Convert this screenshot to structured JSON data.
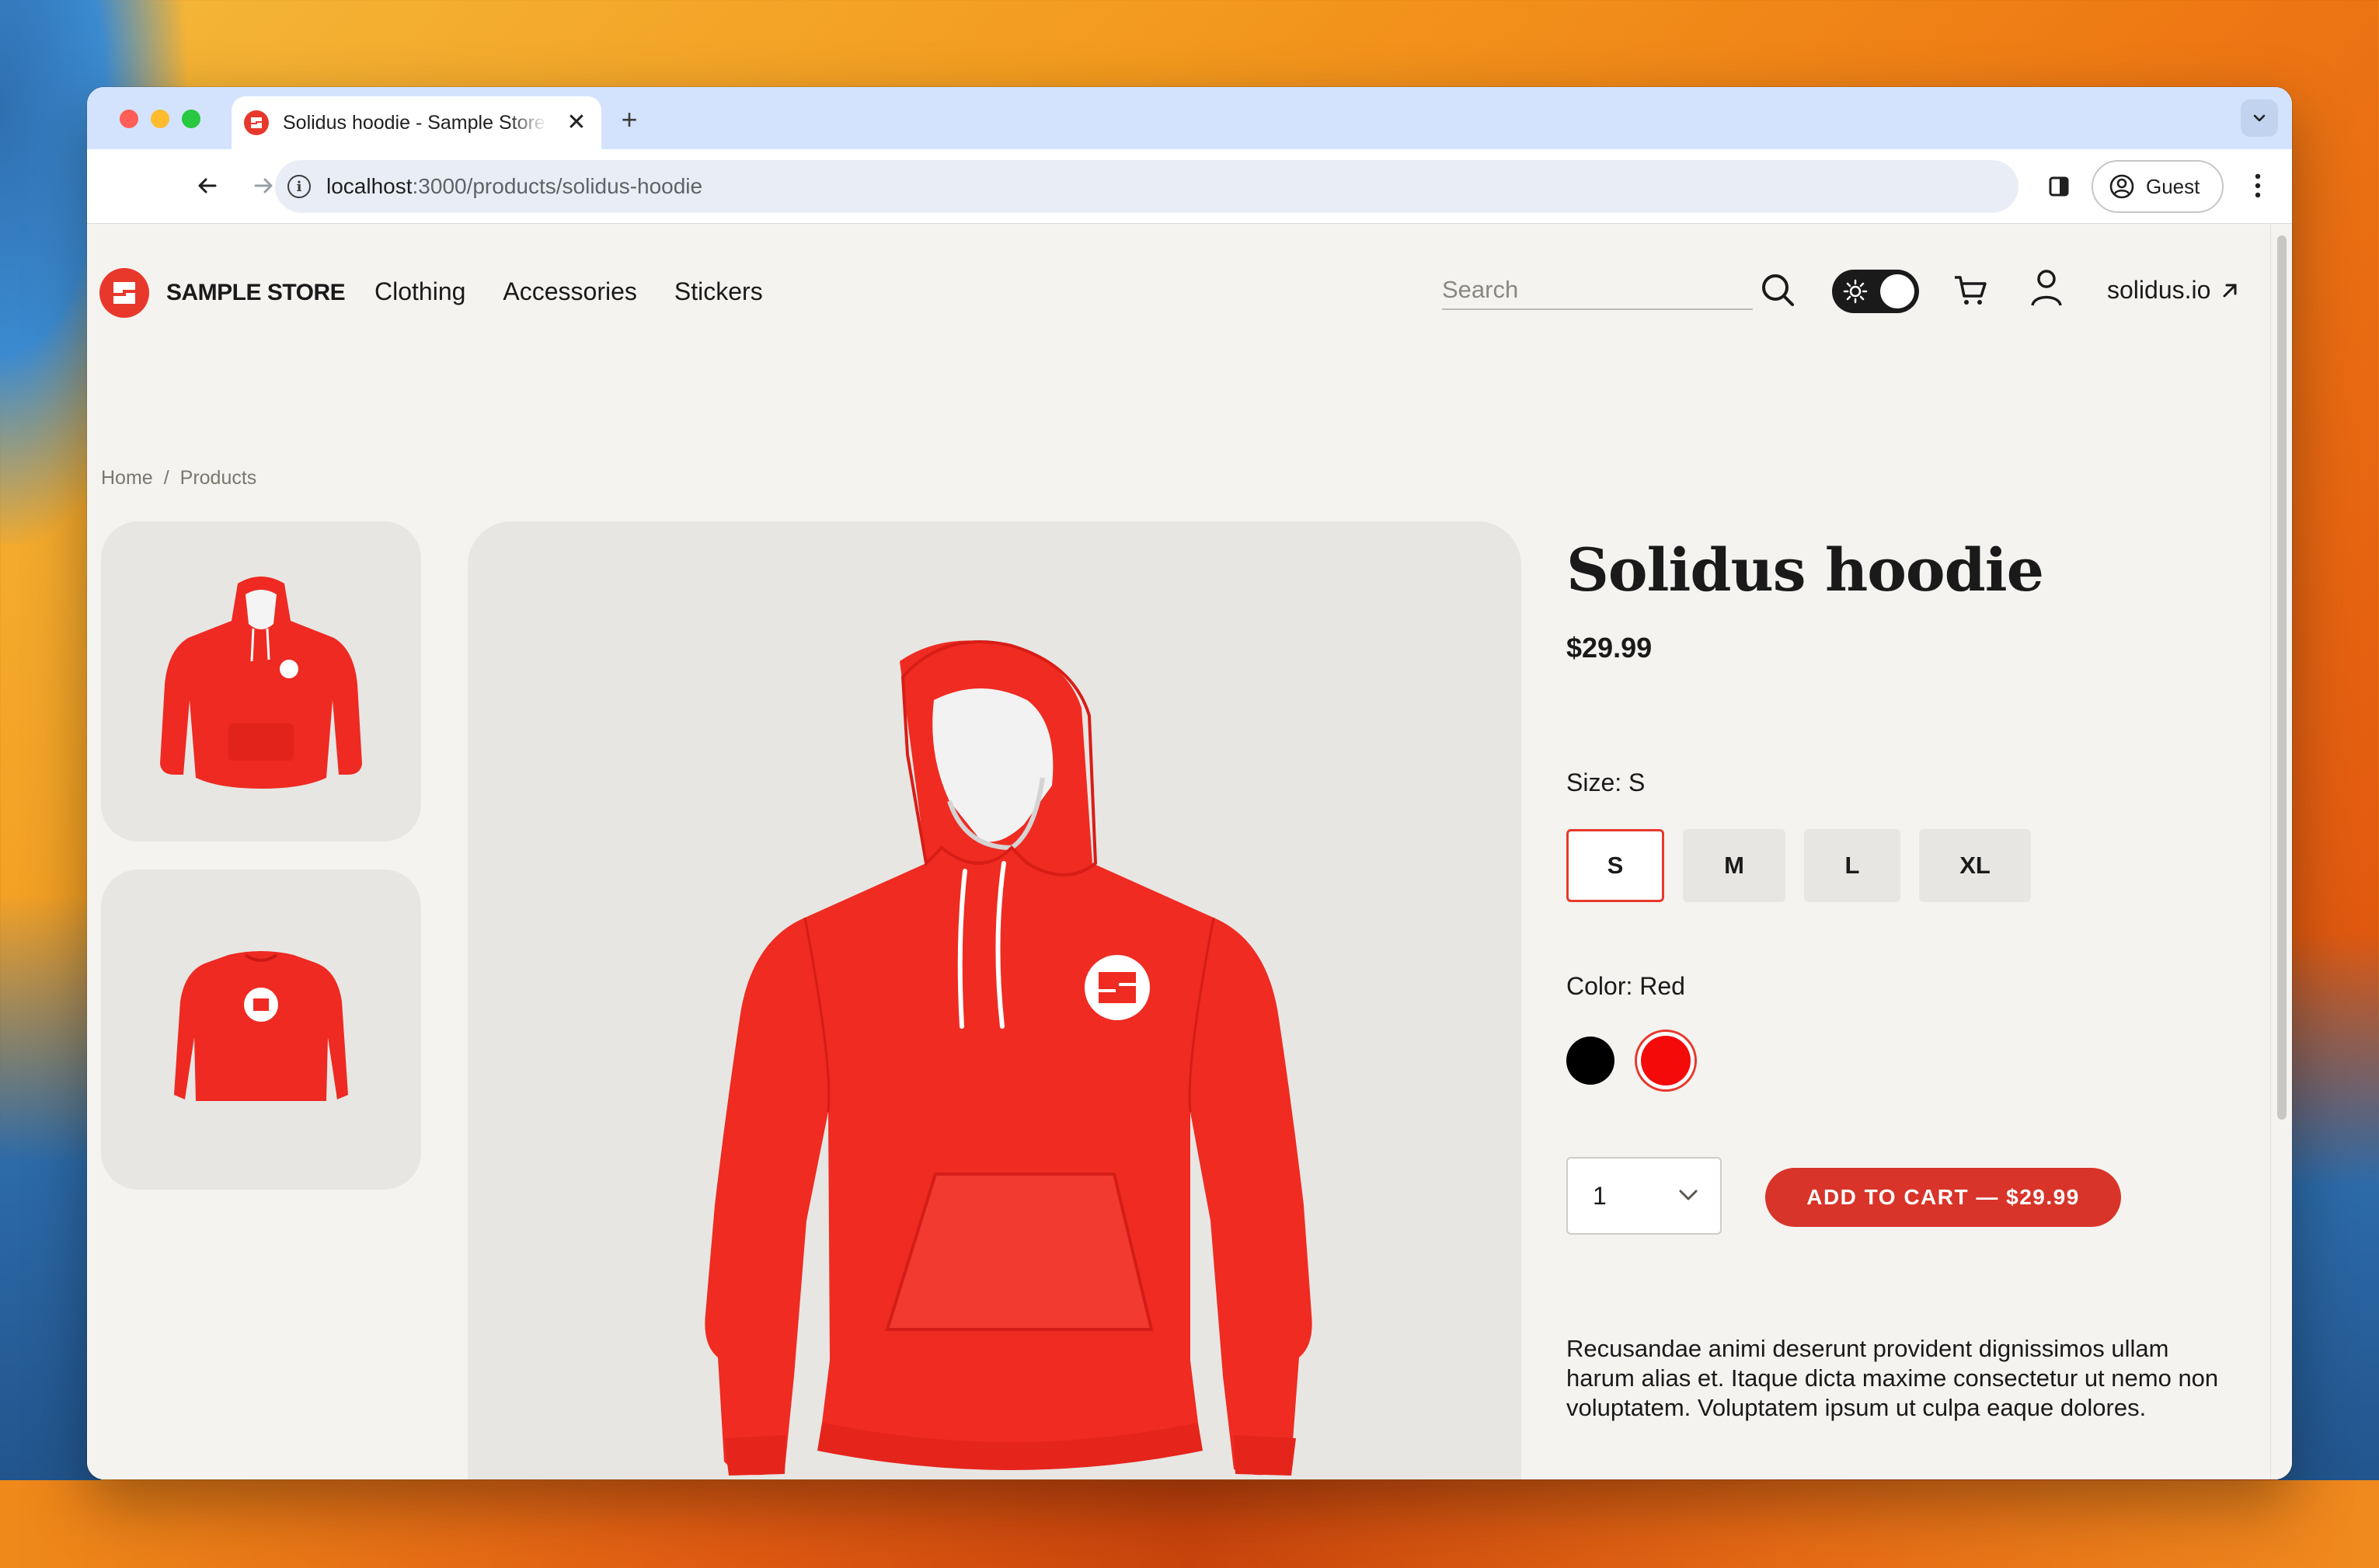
{
  "browser": {
    "tab_title": "Solidus hoodie - Sample Store",
    "new_tab": "+",
    "tab_close": "✕",
    "url_host": "localhost",
    "url_path": ":3000/products/solidus-hoodie",
    "profile_label": "Guest"
  },
  "store": {
    "name": "SAMPLE STORE",
    "nav": [
      "Clothing",
      "Accessories",
      "Stickers"
    ],
    "search_placeholder": "Search",
    "external_link": "solidus.io"
  },
  "breadcrumb": {
    "home": "Home",
    "separator": "/",
    "current": "Products"
  },
  "product": {
    "name": "Solidus hoodie",
    "price": "$29.99",
    "size_label": "Size:",
    "selected_size": "S",
    "sizes": [
      "S",
      "M",
      "L",
      "XL"
    ],
    "color_label": "Color:",
    "selected_color": "Red",
    "colors": [
      {
        "name": "Black",
        "hex": "#000000"
      },
      {
        "name": "Red",
        "hex": "#f50a0a"
      }
    ],
    "quantity": "1",
    "add_to_cart": "ADD TO CART — $29.99",
    "description": "Recusandae animi deserunt provident dignissimos ullam harum alias et. Itaque dicta maxime consectetur ut nemo non voluptatem. Voluptatem ipsum ut culpa eaque dolores."
  },
  "colors": {
    "brand_red": "#e8382c",
    "button_red": "#d8342a",
    "page_bg": "#f4f3f0",
    "tile_bg": "#e7e6e3"
  }
}
